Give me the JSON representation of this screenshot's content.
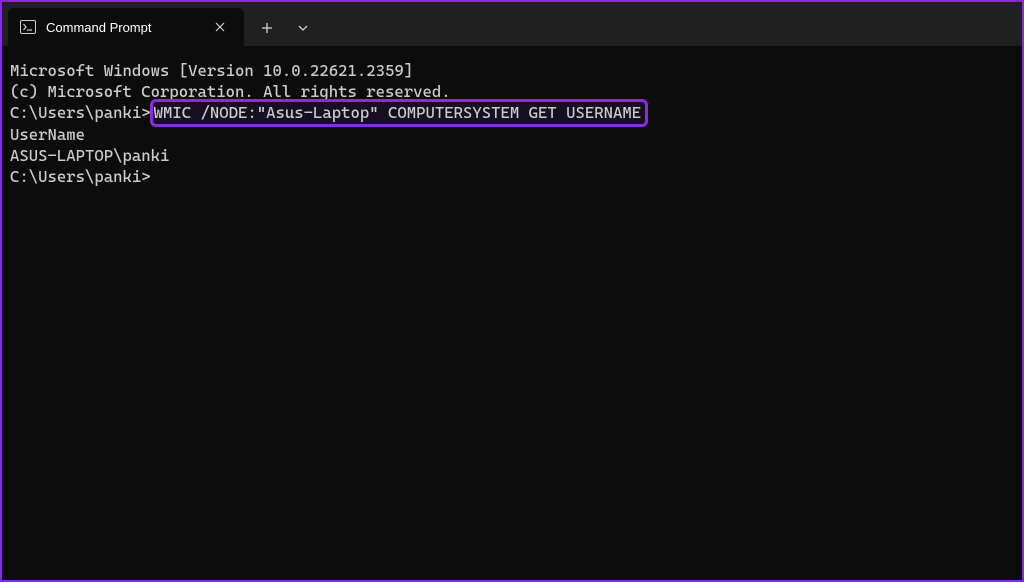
{
  "window": {
    "tab": {
      "title": "Command Prompt"
    }
  },
  "terminal": {
    "line1": "Microsoft Windows [Version 10.0.22621.2359]",
    "line2": "(c) Microsoft Corporation. All rights reserved.",
    "blank1": "",
    "prompt1_prefix": "C:\\Users\\panki>",
    "command1": "WMIC /NODE:\"Asus-Laptop\" COMPUTERSYSTEM GET USERNAME",
    "out_header": "UserName",
    "out_value": "ASUS-LAPTOP\\panki",
    "blank2": "",
    "blank3": "",
    "prompt2": "C:\\Users\\panki>"
  },
  "colors": {
    "highlight_border": "#8a2be2",
    "window_border": "#8a2be2"
  }
}
